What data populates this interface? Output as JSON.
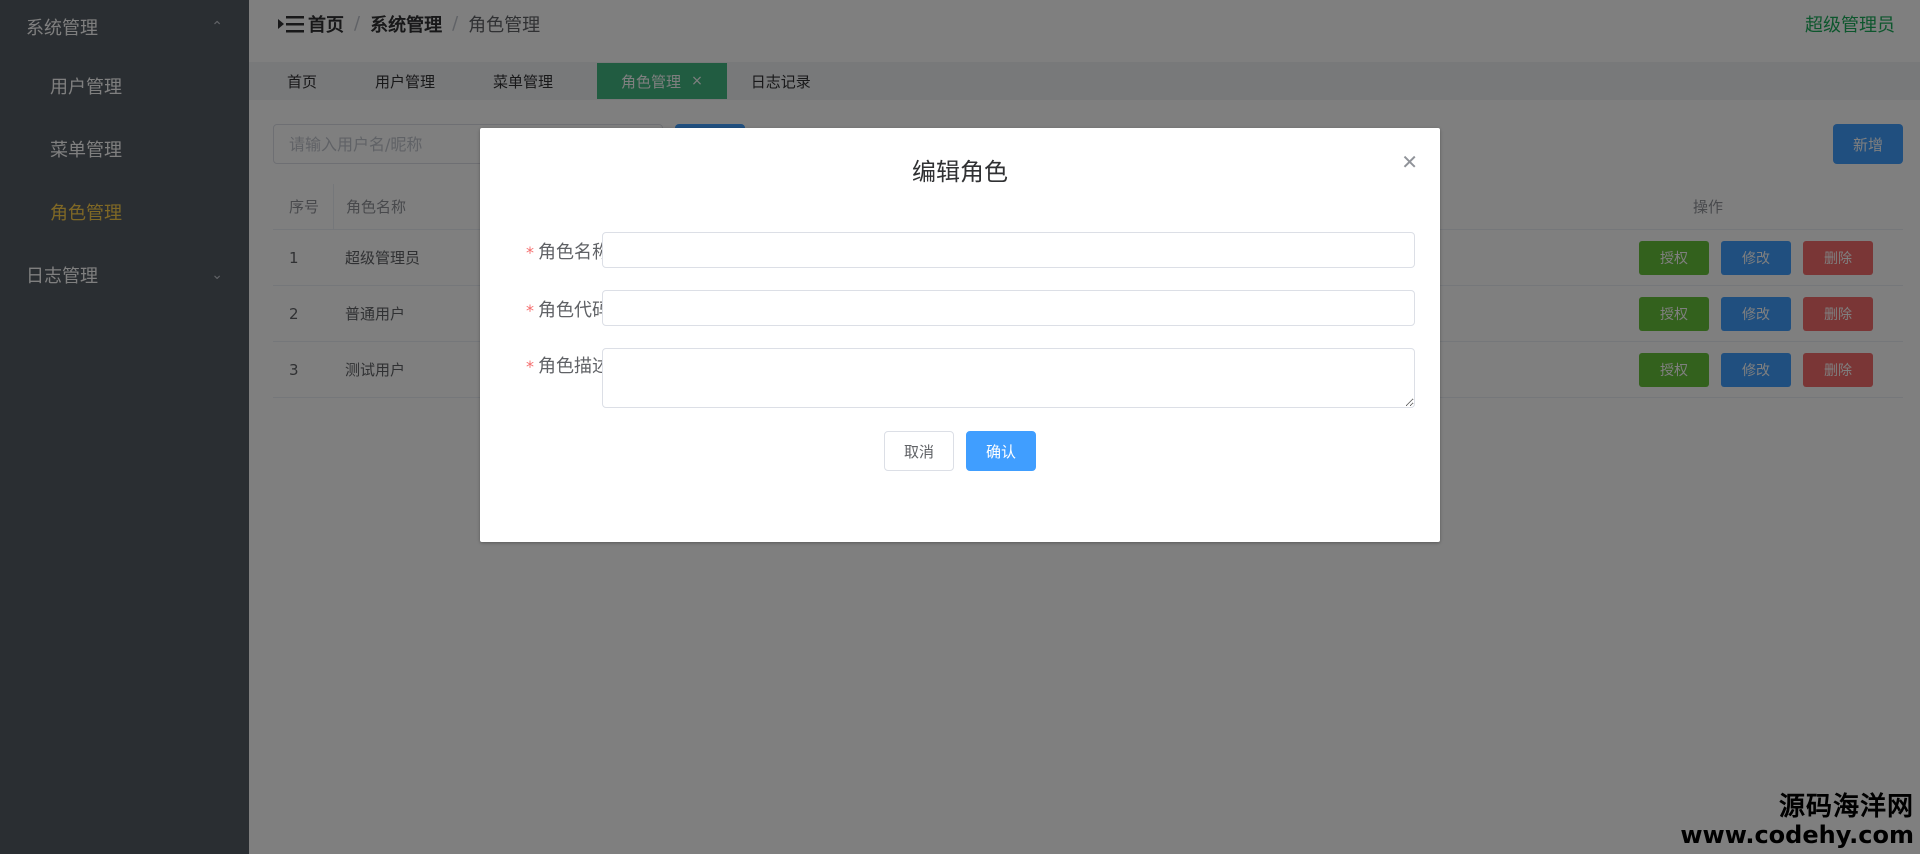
{
  "sidebar": {
    "group_system": "系统管理",
    "items": [
      {
        "label": "用户管理"
      },
      {
        "label": "菜单管理"
      },
      {
        "label": "角色管理"
      }
    ],
    "group_log": "日志管理"
  },
  "header": {
    "breadcrumb": [
      "首页",
      "系统管理",
      "角色管理"
    ],
    "user": "超级管理员"
  },
  "tabs": [
    {
      "label": "首页"
    },
    {
      "label": "用户管理"
    },
    {
      "label": "菜单管理"
    },
    {
      "label": "角色管理",
      "active": true
    },
    {
      "label": "日志记录"
    }
  ],
  "toolbar": {
    "search_placeholder": "请输入用户名/昵称",
    "add_label": "新增"
  },
  "table": {
    "columns": [
      "序号",
      "角色名称",
      "操作"
    ],
    "rows": [
      {
        "index": "1",
        "name": "超级管理员"
      },
      {
        "index": "2",
        "name": "普通用户"
      },
      {
        "index": "3",
        "name": "测试用户"
      }
    ],
    "actions": {
      "auth": "授权",
      "edit": "修改",
      "delete": "删除"
    }
  },
  "dialog": {
    "title": "编辑角色",
    "required_mark": "*",
    "fields": {
      "name_label": "角色名称",
      "code_label": "角色代码",
      "desc_label": "角色描述"
    },
    "cancel_label": "取消",
    "confirm_label": "确认"
  },
  "watermark": {
    "line1": "源码海洋网",
    "line2": "www.codehy.com"
  },
  "colors": {
    "sidebar_bg": "#545c64",
    "sidebar_active": "#ffd04b",
    "tab_active": "#42b983",
    "primary": "#409eff",
    "success": "#67c23a",
    "danger": "#f56c6c"
  }
}
